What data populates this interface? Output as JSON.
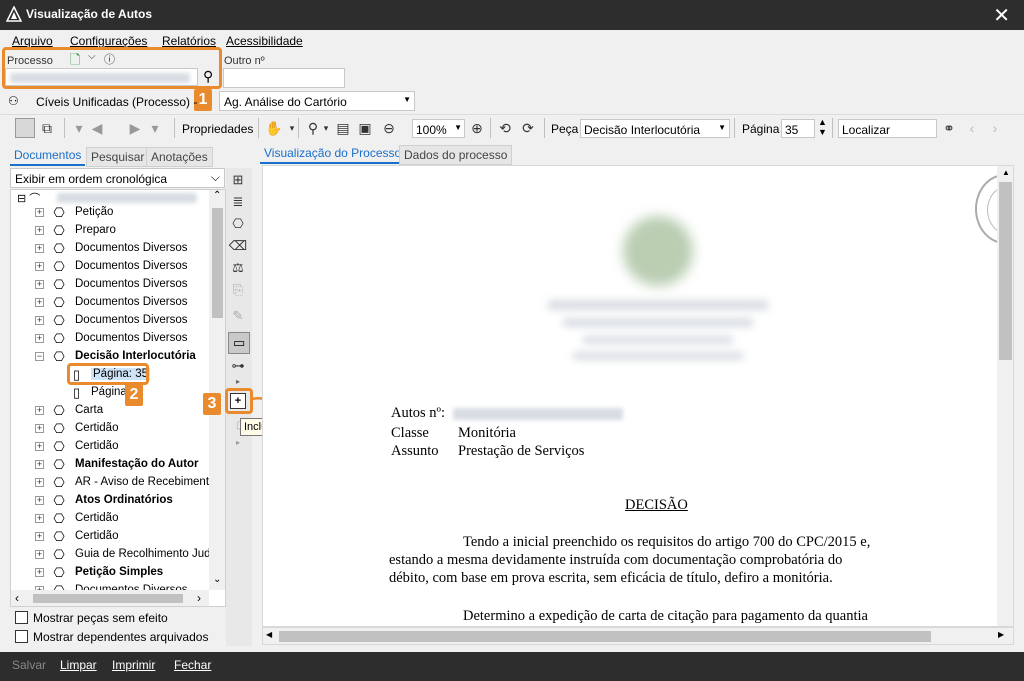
{
  "window": {
    "title": "Visualização de Autos",
    "close_glyph": "✕"
  },
  "menu": [
    {
      "label": "Arquivo"
    },
    {
      "label": "Configurações"
    },
    {
      "label": "Relatórios"
    },
    {
      "label": "Acessibilidade"
    }
  ],
  "process": {
    "label": "Processo",
    "other_label": "Outro nº",
    "class_text": "Cíveis Unificadas (Processo) -",
    "status_select": "Ag. Análise do Cartório"
  },
  "toolbar": {
    "properties_label": "Propriedades",
    "zoom": "100%",
    "piece_label": "Peça",
    "piece_value": "Decisão Interlocutória",
    "page_label": "Página",
    "page_value": "35",
    "search_value": "Localizar"
  },
  "left_tabs": [
    "Documentos",
    "Pesquisar",
    "Anotações"
  ],
  "view_tabs": [
    "Visualização do Processo",
    "Dados do processo"
  ],
  "order_select": "Exibir em ordem cronológica",
  "tree": [
    {
      "label": "Petição",
      "bold": false
    },
    {
      "label": "Preparo",
      "bold": false
    },
    {
      "label": "Documentos Diversos",
      "bold": false
    },
    {
      "label": "Documentos Diversos",
      "bold": false
    },
    {
      "label": "Documentos Diversos",
      "bold": false
    },
    {
      "label": "Documentos Diversos",
      "bold": false
    },
    {
      "label": "Documentos Diversos",
      "bold": false
    },
    {
      "label": "Documentos Diversos",
      "bold": false
    },
    {
      "label": "Decisão Interlocutória",
      "bold": true
    }
  ],
  "tree_pages": [
    "Página: 35",
    "Página"
  ],
  "tree_after": [
    {
      "label": "Carta",
      "bold": false
    },
    {
      "label": "Certidão",
      "bold": false
    },
    {
      "label": "Certidão",
      "bold": false
    },
    {
      "label": "Manifestação do Autor",
      "bold": true
    },
    {
      "label": "AR - Aviso de Recebimento",
      "bold": false
    },
    {
      "label": "Atos Ordinatórios",
      "bold": true
    },
    {
      "label": "Certidão",
      "bold": false
    },
    {
      "label": "Certidão",
      "bold": false
    },
    {
      "label": "Guia de Recolhimento Judi",
      "bold": false
    },
    {
      "label": "Petição Simples",
      "bold": true
    },
    {
      "label": "Documentos Diversos",
      "bold": false
    }
  ],
  "checkboxes": [
    "Mostrar peças sem efeito",
    "Mostrar dependentes arquivados"
  ],
  "tooltip": "Incluir anotação",
  "badges": [
    "1",
    "2",
    "3"
  ],
  "document": {
    "autos_label": "Autos nº:",
    "classe_label": "Classe",
    "classe_value": "Monitória",
    "assunto_label": "Assunto",
    "assunto_value": "Prestação de Serviços",
    "heading": "DECISÃO",
    "p1_l1": "Tendo a inicial preenchido os requisitos do artigo 700 do CPC/2015 e,",
    "p1_l2": "estando a mesma devidamente instruída com documentação comprobatória do",
    "p1_l3": "débito, com base em prova escrita, sem eficácia de título, defiro a monitória.",
    "p2_l1": "Determino a expedição de carta de citação para pagamento da quantia"
  },
  "bottom": [
    "Salvar",
    "Limpar",
    "Imprimir",
    "Fechar"
  ],
  "colors": {
    "accent": "#1a6fc9",
    "highlight": "#e98a2c",
    "titlebar": "#2d2d2d"
  }
}
